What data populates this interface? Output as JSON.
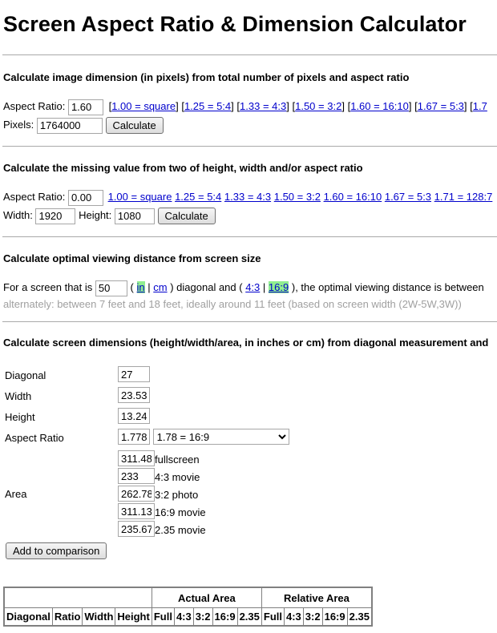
{
  "page": {
    "title": "Screen Aspect Ratio & Dimension Calculator"
  },
  "sec1": {
    "title": "Calculate image dimension (in pixels) from total number of pixels and aspect ratio",
    "aspect_label": "Aspect Ratio:",
    "aspect_value": "1.60",
    "links": [
      "1.00 = square",
      "1.25 = 5:4",
      "1.33 = 4:3",
      "1.50 = 3:2",
      "1.60 = 16:10",
      "1.67 = 5:3",
      "1.7"
    ],
    "pixels_label": "Pixels:",
    "pixels_value": "1764000",
    "calc_label": "Calculate"
  },
  "sec2": {
    "title": "Calculate the missing value from two of height, width and/or aspect ratio",
    "aspect_label": "Aspect Ratio:",
    "aspect_value": "0.00",
    "links": [
      "1.00 = square",
      "1.25 = 5:4",
      "1.33 = 4:3",
      "1.50 = 3:2",
      "1.60 = 16:10",
      "1.67 = 5:3",
      "1.71 = 128:7"
    ],
    "width_label": "Width:",
    "width_value": "1920",
    "height_label": "Height:",
    "height_value": "1080",
    "calc_label": "Calculate"
  },
  "sec3": {
    "title": "Calculate optimal viewing distance from screen size",
    "text_a": "For a screen that is",
    "size_value": "50",
    "open_paren": "(",
    "unit_in": "in",
    "sep": "|",
    "unit_cm": "cm",
    "text_b": ") diagonal and (",
    "ratio_43": "4:3",
    "ratio_169": "16:9",
    "text_c": "), the optimal viewing distance is between",
    "alt_text": "alternately: between 7 feet and 18 feet, ideally around 11 feet (based on screen width (2W-5W,3W))"
  },
  "sec4": {
    "title": "Calculate screen dimensions (height/width/area, in inches or cm) from diagonal measurement and",
    "diagonal_label": "Diagonal",
    "diagonal_value": "27",
    "width_label": "Width",
    "width_value": "23.53",
    "height_label": "Height",
    "height_value": "13.24",
    "aspect_label": "Aspect Ratio",
    "aspect_value": "1.778",
    "aspect_select": "1.78 = 16:9",
    "area_label": "Area",
    "areas": [
      {
        "value": "311.48",
        "label": "fullscreen"
      },
      {
        "value": "233",
        "label": "4:3 movie"
      },
      {
        "value": "262.78",
        "label": "3:2 photo"
      },
      {
        "value": "311.13",
        "label": "16:9 movie"
      },
      {
        "value": "235.67",
        "label": "2.35 movie"
      }
    ],
    "add_label": "Add to comparison"
  },
  "comparison": {
    "group_actual": "Actual Area",
    "group_relative": "Relative Area",
    "headers": [
      "Diagonal",
      "Ratio",
      "Width",
      "Height",
      "Full",
      "4:3",
      "3:2",
      "16:9",
      "2.35",
      "Full",
      "4:3",
      "3:2",
      "16:9",
      "2.35"
    ]
  }
}
